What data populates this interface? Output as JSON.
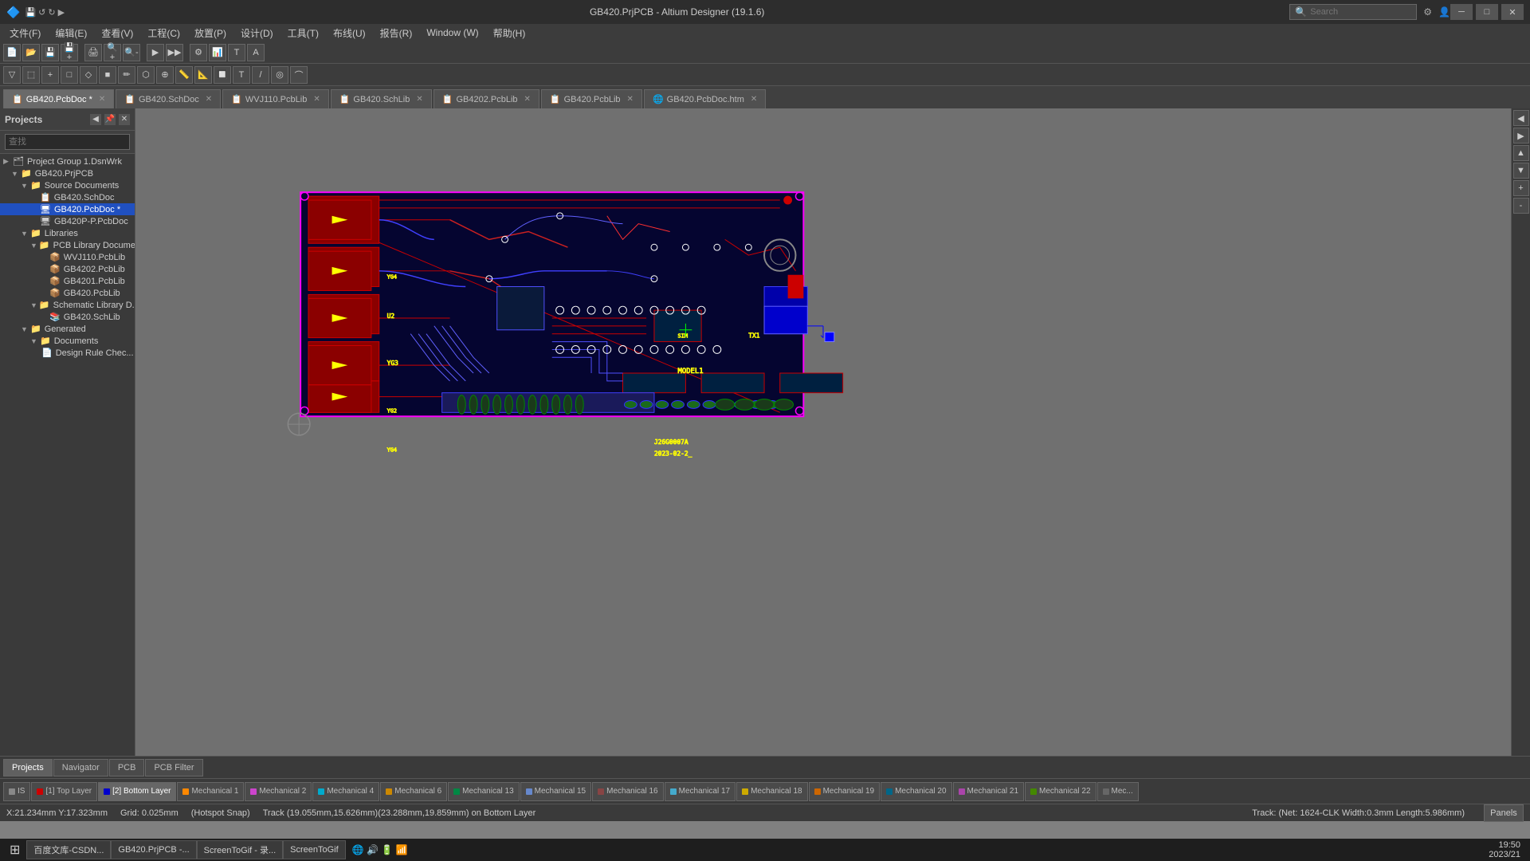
{
  "titlebar": {
    "title": "GB420.PrjPCB - Altium Designer (19.1.6)",
    "search_placeholder": "Search",
    "search_label": "Search",
    "win_minimize": "─",
    "win_restore": "□",
    "win_close": "✕"
  },
  "menubar": {
    "items": [
      {
        "id": "file",
        "label": "文件(F)"
      },
      {
        "id": "edit",
        "label": "编辑(E)"
      },
      {
        "id": "view",
        "label": "查看(V)"
      },
      {
        "id": "project",
        "label": "工程(C)"
      },
      {
        "id": "place",
        "label": "放置(P)"
      },
      {
        "id": "design",
        "label": "设计(D)"
      },
      {
        "id": "tools",
        "label": "工具(T)"
      },
      {
        "id": "route",
        "label": "布线(U)"
      },
      {
        "id": "report",
        "label": "报告(R)"
      },
      {
        "id": "window",
        "label": "Window (W)"
      },
      {
        "id": "help",
        "label": "帮助(H)"
      }
    ]
  },
  "tabs": {
    "items": [
      {
        "id": "pcbdoc",
        "label": "GB420.PcbDoc *",
        "icon": "📋",
        "active": true
      },
      {
        "id": "schdoc",
        "label": "GB420.SchDoc",
        "icon": "📋"
      },
      {
        "id": "wvj110",
        "label": "WVJ110.PcbLib",
        "icon": "📋"
      },
      {
        "id": "gb420lib",
        "label": "GB420.SchLib",
        "icon": "📋"
      },
      {
        "id": "gb402pcblib",
        "label": "GB4202.PcbLib",
        "icon": "📋"
      },
      {
        "id": "gb420pcblib2",
        "label": "GB420.PcbLib",
        "icon": "📋"
      },
      {
        "id": "gb420htm",
        "label": "GB420.PcbDoc.htm",
        "icon": "🌐"
      }
    ]
  },
  "sidebar": {
    "title": "Projects",
    "search_placeholder": "查找",
    "tree": [
      {
        "id": "project-group",
        "label": "Project Group 1.DsnWrk",
        "level": 0,
        "type": "group",
        "icon": "▶"
      },
      {
        "id": "gb420-prjpcb",
        "label": "GB420.PrjPCB",
        "level": 1,
        "type": "project",
        "icon": "▼"
      },
      {
        "id": "source-docs",
        "label": "Source Documents",
        "level": 2,
        "type": "folder",
        "icon": "▼"
      },
      {
        "id": "gb420-schdoc",
        "label": "GB420.SchDoc",
        "level": 3,
        "type": "schdoc"
      },
      {
        "id": "gb420-pcbdoc",
        "label": "GB420.PcbDoc *",
        "level": 3,
        "type": "pcbdoc",
        "selected": true
      },
      {
        "id": "gb420p-pcbdoc",
        "label": "GB420P-P.PcbDoc",
        "level": 3,
        "type": "pcbdoc"
      },
      {
        "id": "libraries",
        "label": "Libraries",
        "level": 2,
        "type": "folder",
        "icon": "▼"
      },
      {
        "id": "pcb-library-docs",
        "label": "PCB Library Docume...",
        "level": 3,
        "type": "folder",
        "icon": "▼"
      },
      {
        "id": "wvj110-pcblib",
        "label": "WVJ110.PcbLib",
        "level": 4,
        "type": "pcblib"
      },
      {
        "id": "gb4202-pcblib",
        "label": "GB4202.PcbLib",
        "level": 4,
        "type": "pcblib"
      },
      {
        "id": "gb4201-pcblib",
        "label": "GB4201.PcbLib",
        "level": 4,
        "type": "pcblib"
      },
      {
        "id": "gb420-pcblib",
        "label": "GB420.PcbLib",
        "level": 4,
        "type": "pcblib"
      },
      {
        "id": "schematic-lib-docs",
        "label": "Schematic Library D...",
        "level": 3,
        "type": "folder",
        "icon": "▼"
      },
      {
        "id": "gb420-schlib",
        "label": "GB420.SchLib",
        "level": 4,
        "type": "schlib"
      },
      {
        "id": "generated",
        "label": "Generated",
        "level": 2,
        "type": "folder",
        "icon": "▼"
      },
      {
        "id": "documents",
        "label": "Documents",
        "level": 3,
        "type": "folder",
        "icon": "▼"
      },
      {
        "id": "design-rule-check",
        "label": "Design Rule Chec...",
        "level": 4,
        "type": "doc"
      }
    ]
  },
  "layer_tabs": [
    {
      "id": "is",
      "label": "IS",
      "color": "#888888"
    },
    {
      "id": "top-layer",
      "label": "[1] Top Layer",
      "color": "#cc0000"
    },
    {
      "id": "bottom-layer",
      "label": "[2] Bottom Layer",
      "color": "#0000cc",
      "active": true
    },
    {
      "id": "mech1",
      "label": "Mechanical 1",
      "color": "#ff8800"
    },
    {
      "id": "mech2",
      "label": "Mechanical 2",
      "color": "#cc44cc"
    },
    {
      "id": "mech4",
      "label": "Mechanical 4",
      "color": "#00aacc"
    },
    {
      "id": "mech6",
      "label": "Mechanical 6",
      "color": "#cc8800"
    },
    {
      "id": "mech13",
      "label": "Mechanical 13",
      "color": "#008844"
    },
    {
      "id": "mech15",
      "label": "Mechanical 15",
      "color": "#6688cc"
    },
    {
      "id": "mech16",
      "label": "Mechanical 16",
      "color": "#884444"
    },
    {
      "id": "mech17",
      "label": "Mechanical 17",
      "color": "#44aacc"
    },
    {
      "id": "mech18",
      "label": "Mechanical 18",
      "color": "#ccaa00"
    },
    {
      "id": "mech19",
      "label": "Mechanical 19",
      "color": "#cc6600"
    },
    {
      "id": "mech20",
      "label": "Mechanical 20",
      "color": "#006688"
    },
    {
      "id": "mech21",
      "label": "Mechanical 21",
      "color": "#aa44aa"
    },
    {
      "id": "mech22",
      "label": "Mechanical 22",
      "color": "#448800"
    },
    {
      "id": "mec-more",
      "label": "Mec...",
      "color": "#666666"
    }
  ],
  "nav_tabs": [
    {
      "id": "projects",
      "label": "Projects",
      "active": true
    },
    {
      "id": "navigator",
      "label": "Navigator"
    },
    {
      "id": "pcb",
      "label": "PCB"
    },
    {
      "id": "pcb-filter",
      "label": "PCB Filter"
    }
  ],
  "status": {
    "coords": "X:21.234mm Y:17.323mm",
    "grid": "Grid: 0.025mm",
    "snap": "(Hotspot Snap)",
    "track_info": "Track (19.055mm,15.626mm)(23.288mm,19.859mm) on Bottom Layer",
    "net_info": "Track: (Net: 1624-CLK Width:0.3mm Length:5.986mm)"
  },
  "taskbar": {
    "items": [
      {
        "id": "start",
        "label": "⊞"
      },
      {
        "id": "chrome",
        "label": "百度文库-CSDN..."
      },
      {
        "id": "altium",
        "label": "GB420.PrjPCB -..."
      },
      {
        "id": "screentogif",
        "label": "ScreenToGif - 录..."
      },
      {
        "id": "screentogif2",
        "label": "ScreenToGif"
      }
    ],
    "time": "19:50",
    "date": "2023/21"
  },
  "panels_label": "Panels"
}
